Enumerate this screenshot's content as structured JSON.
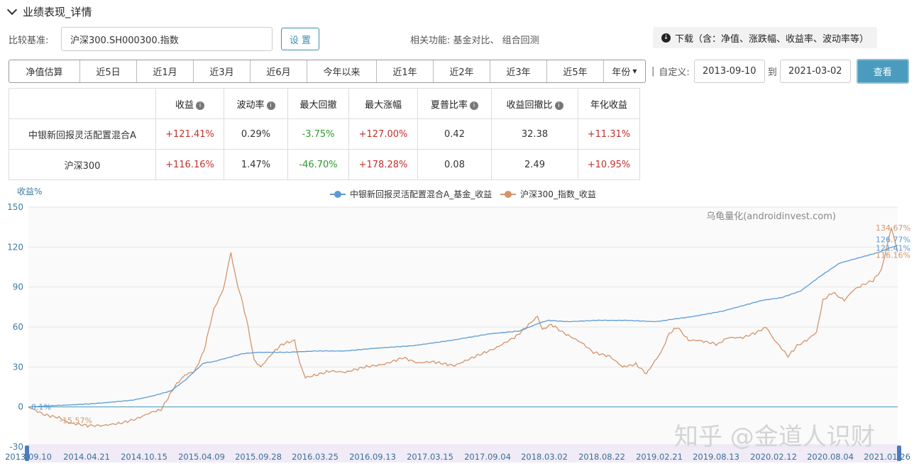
{
  "header": {
    "title": "业绩表现_详情"
  },
  "benchmark": {
    "label": "比较基准:",
    "value": "沪深300.SH000300.指数",
    "set_label": "设 置"
  },
  "related": {
    "text": "相关功能:  基金对比、 组合回测"
  },
  "download": {
    "label": "下载（含：净值、涨跌幅、收益率、波动率等）"
  },
  "tabs": [
    "净值估算",
    "近5日",
    "近1月",
    "近3月",
    "近6月",
    "今年以来",
    "近1年",
    "近2年",
    "近3年",
    "近5年",
    "年份"
  ],
  "range": {
    "custom_label": "自定义:",
    "from": "2013-09-10",
    "to_label": "到",
    "to": "2021-03-02",
    "query_label": "查看",
    "sep": "|"
  },
  "table": {
    "headers": [
      "收益",
      "波动率",
      "最大回撤",
      "最大涨幅",
      "夏普比率",
      "收益回撤比",
      "年化收益"
    ],
    "info_flags": [
      true,
      true,
      false,
      false,
      true,
      true,
      false
    ],
    "rows": [
      {
        "name": "中银新回报灵活配置混合A",
        "cells": [
          "+121.41%",
          "0.29%",
          "-3.75%",
          "+127.00%",
          "0.42",
          "32.38",
          "+11.31%"
        ]
      },
      {
        "name": "沪深300",
        "cells": [
          "+116.16%",
          "1.47%",
          "-46.70%",
          "+178.28%",
          "0.08",
          "2.49",
          "+10.95%"
        ]
      }
    ]
  },
  "watermark": "知乎 @金道人识财",
  "chart_data": {
    "type": "line",
    "ylabel": "收益%",
    "ylim": [
      -30,
      150
    ],
    "yticks": [
      -30,
      0,
      30,
      60,
      90,
      120,
      150
    ],
    "grid": true,
    "legend_position": "top-center",
    "source_note": "乌龟量化(androidinvest.com)",
    "x_ticks": [
      "2013.09.10",
      "2014.04.21",
      "2014.10.15",
      "2015.04.09",
      "2015.09.28",
      "2016.03.25",
      "2016.09.13",
      "2017.03.15",
      "2017.09.04",
      "2018.03.02",
      "2018.08.22",
      "2019.02.21",
      "2019.08.13",
      "2020.02.12",
      "2020.08.04",
      "2021.01.26"
    ],
    "x_range": [
      "2013-09-10",
      "2021-03-02"
    ],
    "series": [
      {
        "name": "中银新回报灵活配置混合A_基金_收益",
        "color": "#5b9bd5",
        "points": [
          [
            "2013-09-10",
            0
          ],
          [
            "2013-12-01",
            1
          ],
          [
            "2014-03-01",
            2
          ],
          [
            "2014-05-01",
            3
          ],
          [
            "2014-08-01",
            5
          ],
          [
            "2014-10-01",
            8
          ],
          [
            "2014-12-01",
            12
          ],
          [
            "2015-01-15",
            20
          ],
          [
            "2015-02-15",
            27
          ],
          [
            "2015-03-15",
            33
          ],
          [
            "2015-04-15",
            34
          ],
          [
            "2015-05-15",
            36
          ],
          [
            "2015-06-15",
            38
          ],
          [
            "2015-07-15",
            40
          ],
          [
            "2015-09-01",
            41
          ],
          [
            "2015-12-01",
            41
          ],
          [
            "2016-03-01",
            42
          ],
          [
            "2016-06-01",
            42
          ],
          [
            "2016-09-01",
            44
          ],
          [
            "2017-01-01",
            46
          ],
          [
            "2017-05-01",
            50
          ],
          [
            "2017-09-01",
            55
          ],
          [
            "2017-12-01",
            57
          ],
          [
            "2018-02-01",
            63
          ],
          [
            "2018-03-01",
            65
          ],
          [
            "2018-05-01",
            64
          ],
          [
            "2018-08-01",
            65
          ],
          [
            "2018-11-01",
            65
          ],
          [
            "2019-02-01",
            64
          ],
          [
            "2019-04-01",
            66
          ],
          [
            "2019-06-01",
            68
          ],
          [
            "2019-09-01",
            72
          ],
          [
            "2019-11-01",
            76
          ],
          [
            "2020-01-01",
            80
          ],
          [
            "2020-03-01",
            82
          ],
          [
            "2020-05-01",
            87
          ],
          [
            "2020-07-01",
            98
          ],
          [
            "2020-09-01",
            108
          ],
          [
            "2020-11-01",
            112
          ],
          [
            "2021-01-01",
            116
          ],
          [
            "2021-02-01",
            119
          ],
          [
            "2021-03-02",
            121.41
          ]
        ]
      },
      {
        "name": "沪深300_指数_收益",
        "color": "#d4946a",
        "points": [
          [
            "2013-09-10",
            0
          ],
          [
            "2013-11-01",
            -6
          ],
          [
            "2013-12-15",
            -8
          ],
          [
            "2014-01-15",
            -12
          ],
          [
            "2014-03-15",
            -14
          ],
          [
            "2014-05-01",
            -14
          ],
          [
            "2014-07-01",
            -12
          ],
          [
            "2014-08-15",
            -9
          ],
          [
            "2014-10-01",
            -4
          ],
          [
            "2014-11-01",
            -2
          ],
          [
            "2014-12-15",
            16
          ],
          [
            "2015-01-15",
            24
          ],
          [
            "2015-02-15",
            27
          ],
          [
            "2015-03-15",
            42
          ],
          [
            "2015-04-15",
            73
          ],
          [
            "2015-05-15",
            88
          ],
          [
            "2015-06-08",
            116
          ],
          [
            "2015-06-25",
            95
          ],
          [
            "2015-07-15",
            78
          ],
          [
            "2015-08-01",
            60
          ],
          [
            "2015-08-20",
            35
          ],
          [
            "2015-09-10",
            30
          ],
          [
            "2015-10-15",
            40
          ],
          [
            "2015-11-15",
            47
          ],
          [
            "2015-12-25",
            50
          ],
          [
            "2016-01-10",
            33
          ],
          [
            "2016-01-28",
            22
          ],
          [
            "2016-03-01",
            24
          ],
          [
            "2016-04-15",
            27
          ],
          [
            "2016-06-01",
            26
          ],
          [
            "2016-08-01",
            30
          ],
          [
            "2016-10-01",
            32
          ],
          [
            "2016-11-30",
            37
          ],
          [
            "2017-01-15",
            33
          ],
          [
            "2017-03-01",
            34
          ],
          [
            "2017-05-10",
            31
          ],
          [
            "2017-07-15",
            38
          ],
          [
            "2017-09-15",
            44
          ],
          [
            "2017-11-20",
            53
          ],
          [
            "2018-01-26",
            68
          ],
          [
            "2018-02-10",
            58
          ],
          [
            "2018-03-10",
            62
          ],
          [
            "2018-04-15",
            56
          ],
          [
            "2018-06-15",
            48
          ],
          [
            "2018-07-20",
            41
          ],
          [
            "2018-09-10",
            38
          ],
          [
            "2018-10-20",
            30
          ],
          [
            "2018-12-01",
            32
          ],
          [
            "2019-01-03",
            25
          ],
          [
            "2019-02-20",
            42
          ],
          [
            "2019-03-15",
            55
          ],
          [
            "2019-04-10",
            60
          ],
          [
            "2019-05-15",
            50
          ],
          [
            "2019-06-15",
            50
          ],
          [
            "2019-08-15",
            47
          ],
          [
            "2019-09-15",
            52
          ],
          [
            "2019-11-01",
            52
          ],
          [
            "2019-12-15",
            56
          ],
          [
            "2020-01-15",
            60
          ],
          [
            "2020-02-03",
            52
          ],
          [
            "2020-03-23",
            38
          ],
          [
            "2020-04-20",
            46
          ],
          [
            "2020-05-20",
            50
          ],
          [
            "2020-06-20",
            56
          ],
          [
            "2020-07-10",
            80
          ],
          [
            "2020-08-10",
            86
          ],
          [
            "2020-09-15",
            80
          ],
          [
            "2020-10-15",
            88
          ],
          [
            "2020-11-15",
            92
          ],
          [
            "2020-12-15",
            95
          ],
          [
            "2021-01-10",
            103
          ],
          [
            "2021-02-10",
            134.67
          ],
          [
            "2021-03-02",
            116.16
          ]
        ]
      }
    ],
    "data_labels": [
      {
        "text": "0.1%",
        "series": 0
      },
      {
        "text": "-15.57%",
        "series": 1
      },
      {
        "text": "134.67%",
        "series": 1
      },
      {
        "text": "126.77%",
        "series": 0
      },
      {
        "text": "121.41%",
        "series": 0
      },
      {
        "text": "116.16%",
        "series": 1
      }
    ]
  }
}
